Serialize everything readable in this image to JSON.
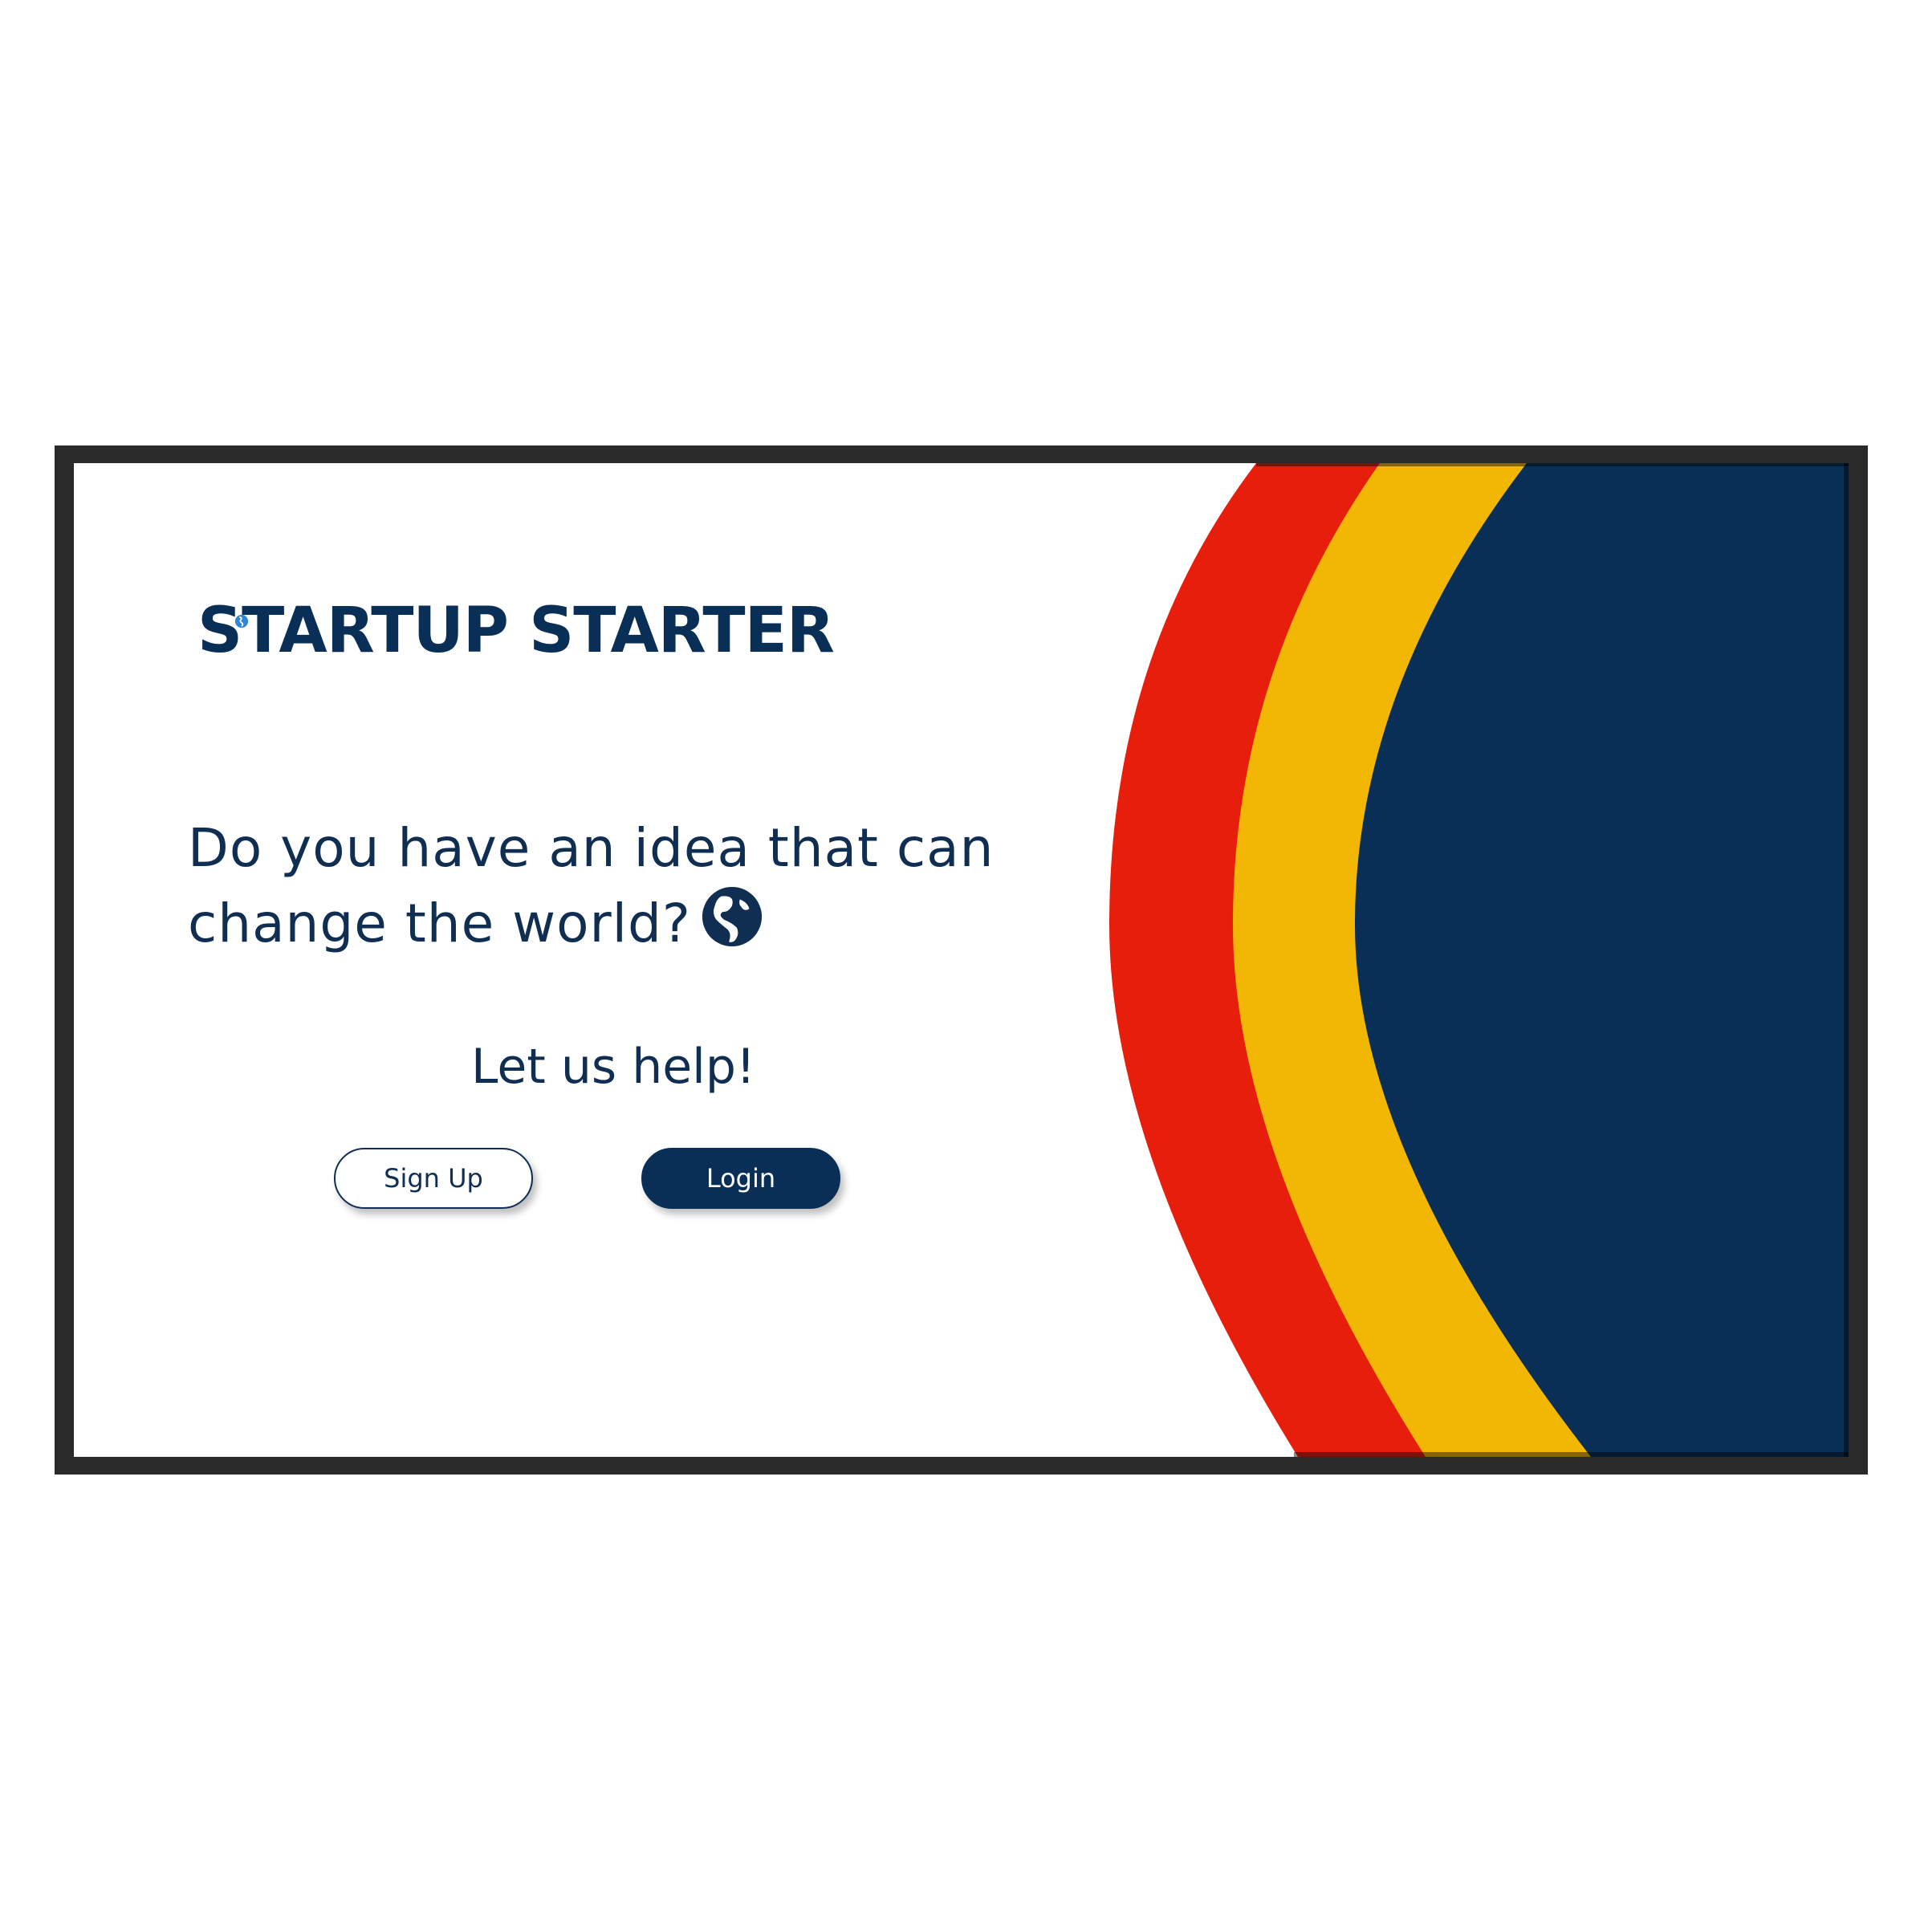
{
  "brand": {
    "name": "STARTUP STARTER"
  },
  "hero": {
    "headline_line1": "Do you have an idea that can",
    "headline_line2": "change the world?",
    "tagline": "Let us help!"
  },
  "actions": {
    "signup_label": "Sign Up",
    "login_label": "Login"
  },
  "icons": {
    "headline_icon": "globe-icon",
    "logo_icon": "globe-icon"
  },
  "colors": {
    "navy": "#0a2f57",
    "red": "#e81e0c",
    "yellow": "#f2b705",
    "frame": "#2a2a2a",
    "background": "#ffffff"
  }
}
